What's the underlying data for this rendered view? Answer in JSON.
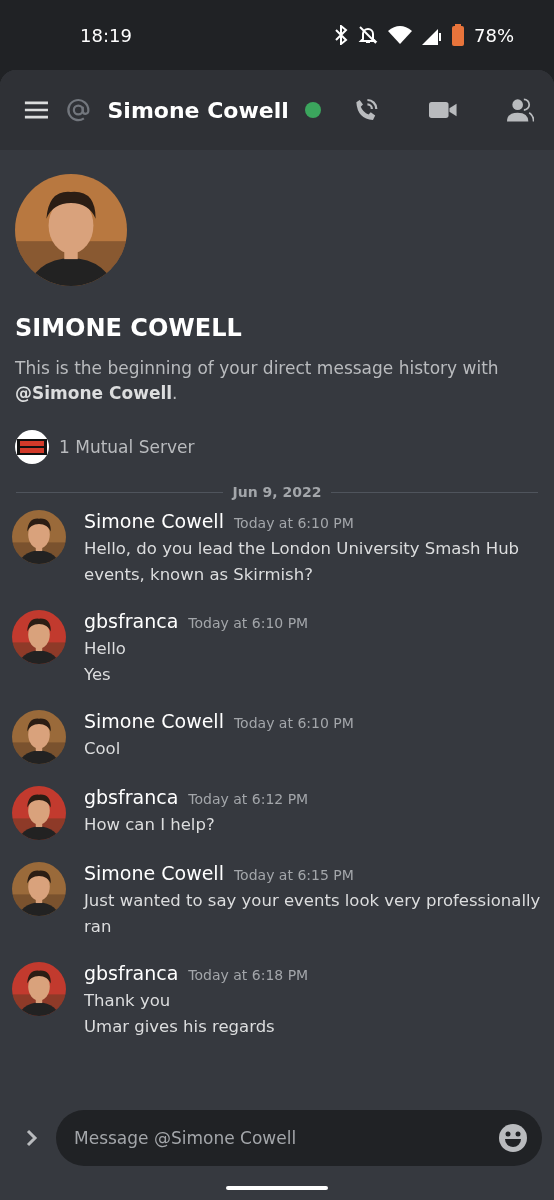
{
  "status_bar": {
    "time": "18:19",
    "battery": "78%"
  },
  "header": {
    "title": "Simone Cowell",
    "online": true
  },
  "profile": {
    "name": "SIMONE COWELL",
    "description": "This is the beginning of your direct message history with **@Simone Cowell**.",
    "mutual_servers": "1 Mutual Server"
  },
  "date_divider": "Jun 9, 2022",
  "messages": [
    {
      "author": "Simone Cowell",
      "time": "Today at 6:10 PM",
      "color": "#9a6a3a",
      "lines": [
        "Hello, do you lead the London University Smash Hub events, known as Skirmish?"
      ]
    },
    {
      "author": "gbsfranca",
      "time": "Today at 6:10 PM",
      "color": "#c23a2e",
      "lines": [
        "Hello",
        "Yes"
      ]
    },
    {
      "author": "Simone Cowell",
      "time": "Today at 6:10 PM",
      "color": "#9a6a3a",
      "lines": [
        "Cool"
      ]
    },
    {
      "author": "gbsfranca",
      "time": "Today at 6:12 PM",
      "color": "#c23a2e",
      "lines": [
        "How can I help?"
      ]
    },
    {
      "author": "Simone Cowell",
      "time": "Today at 6:15 PM",
      "color": "#9a6a3a",
      "lines": [
        "Just wanted to say your events look very professionally ran"
      ]
    },
    {
      "author": "gbsfranca",
      "time": "Today at 6:18 PM",
      "color": "#c23a2e",
      "lines": [
        "Thank you",
        "Umar gives his regards"
      ]
    }
  ],
  "composer": {
    "placeholder": "Message @Simone Cowell"
  }
}
